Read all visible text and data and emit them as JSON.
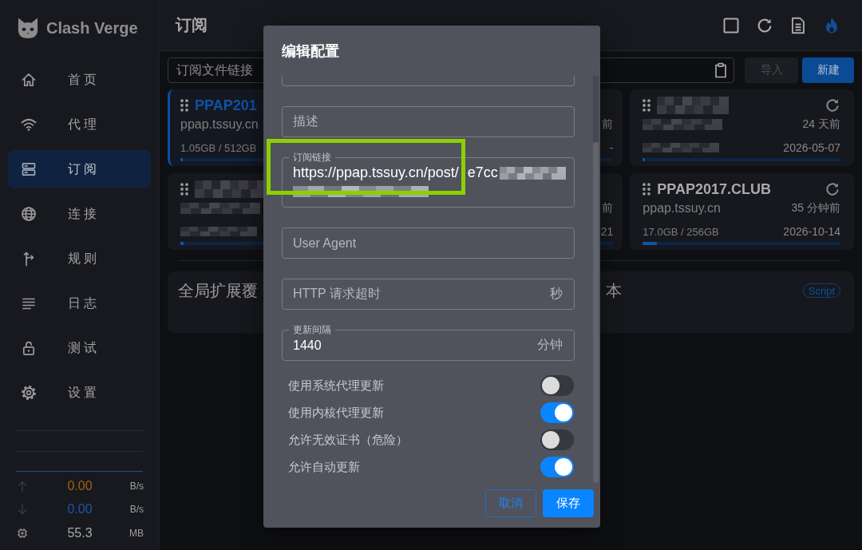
{
  "app": {
    "name": "Clash Verge"
  },
  "nav": [
    {
      "label": "首页",
      "selected": false
    },
    {
      "label": "代理",
      "selected": false
    },
    {
      "label": "订阅",
      "selected": true
    },
    {
      "label": "连接",
      "selected": false
    },
    {
      "label": "规则",
      "selected": false
    },
    {
      "label": "日志",
      "selected": false
    },
    {
      "label": "测试",
      "selected": false
    },
    {
      "label": "设置",
      "selected": false
    }
  ],
  "traffic": [
    {
      "kind": "upload",
      "value": "0.00",
      "unit": "B/s"
    },
    {
      "kind": "download",
      "value": "0.00",
      "unit": "B/s"
    },
    {
      "kind": "memory",
      "value": "55.3",
      "unit": "MB"
    }
  ],
  "header": {
    "title": "订阅"
  },
  "import_bar": {
    "placeholder": "订阅文件链接",
    "buttons": [
      {
        "label": "导入",
        "disabled": true
      },
      {
        "label": "新建",
        "disabled": false
      }
    ]
  },
  "profiles": [
    {
      "kind": "full",
      "selected": true,
      "redacted": false,
      "title": "PPAP201",
      "host": "ppap.tssuy.cn",
      "usage": "1.05GB / 512GB",
      "level": 0.011
    },
    {
      "kind": "partial",
      "updated": "前",
      "expires": "-"
    },
    {
      "kind": "full",
      "selected": false,
      "redacted": true,
      "updated": "24 天前",
      "expires": "2026-05-07",
      "level": 0.011
    },
    {
      "kind": "full",
      "selected": false,
      "redacted": true,
      "level": 0.015
    },
    {
      "kind": "partial",
      "updated": "前",
      "expires": "21"
    },
    {
      "kind": "full",
      "selected": false,
      "redacted": false,
      "title": "PPAP2017.CLUB",
      "host": "ppap.tssuy.cn",
      "updated": "35 分钟前",
      "usage": "17.0GB / 256GB",
      "expires": "2026-10-14",
      "level": 0.07
    }
  ],
  "global_cards": [
    {
      "title": "全局扩展覆"
    },
    {
      "title": "本",
      "tag": "Script"
    }
  ],
  "dialog": {
    "title": "编辑配置",
    "fields": [
      {
        "kind": "partial"
      },
      {
        "kind": "plain",
        "placeholder": "描述"
      },
      {
        "kind": "labeled",
        "label": "订阅链接",
        "value_pieces": [
          "https://ppap.tssuy.cn/post/",
          "e7cc"
        ],
        "redacted": true
      },
      {
        "kind": "plain",
        "placeholder": "User Agent"
      },
      {
        "kind": "plain",
        "placeholder": "HTTP 请求超时",
        "suffix": "秒"
      },
      {
        "kind": "labeled",
        "label": "更新间隔",
        "value": "1440",
        "suffix": "分钟"
      }
    ],
    "switches": [
      {
        "label": "使用系统代理更新",
        "on": false
      },
      {
        "label": "使用内核代理更新",
        "on": true
      },
      {
        "label": "允许无效证书（危险）",
        "on": false
      },
      {
        "label": "允许自动更新",
        "on": true
      }
    ],
    "buttons": [
      {
        "label": "取消",
        "kind": "outlined"
      },
      {
        "label": "保存",
        "kind": "contained"
      }
    ]
  }
}
